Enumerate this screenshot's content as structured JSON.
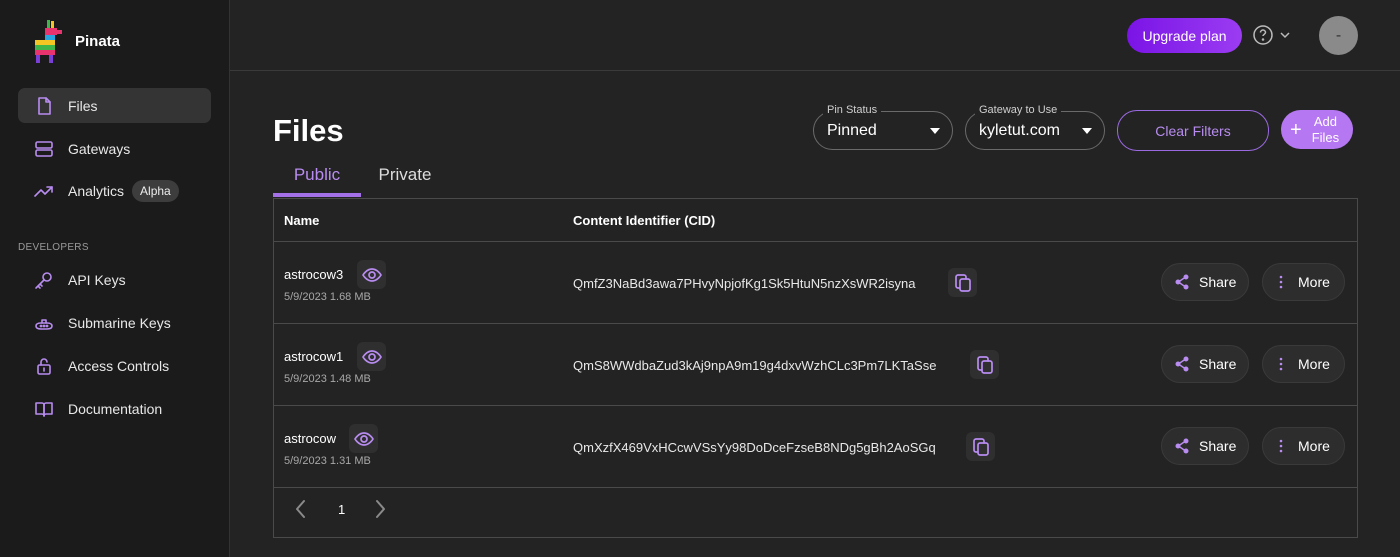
{
  "app": {
    "brand_name": "Pinata"
  },
  "sidebar": {
    "items": [
      {
        "label": "Files",
        "icon": "file-icon",
        "active": true
      },
      {
        "label": "Gateways",
        "icon": "server-icon",
        "active": false
      },
      {
        "label": "Analytics",
        "icon": "trend-up-icon",
        "active": false,
        "badge": "Alpha"
      }
    ],
    "section_label": "DEVELOPERS",
    "developer_items": [
      {
        "label": "API Keys",
        "icon": "key-icon"
      },
      {
        "label": "Submarine Keys",
        "icon": "submarine-icon"
      },
      {
        "label": "Access Controls",
        "icon": "lock-icon"
      },
      {
        "label": "Documentation",
        "icon": "book-icon"
      }
    ]
  },
  "topbar": {
    "upgrade_label": "Upgrade plan",
    "help_icon": "question-circle-icon",
    "avatar_text": "-"
  },
  "main": {
    "title": "Files",
    "filters": {
      "pin_status": {
        "legend": "Pin Status",
        "value": "Pinned"
      },
      "gateway": {
        "legend": "Gateway to Use",
        "value": "kyletut.com"
      }
    },
    "clear_filters_label": "Clear Filters",
    "add_files_label_line1": "Add",
    "add_files_label_line2": "Files",
    "tabs": [
      {
        "label": "Public",
        "active": true
      },
      {
        "label": "Private",
        "active": false
      }
    ],
    "table": {
      "columns": [
        "Name",
        "Content Identifier (CID)"
      ],
      "rows": [
        {
          "name": "astrocow3",
          "date": "5/9/2023",
          "size": "1.68 MB",
          "cid": "QmfZ3NaBd3awa7PHvyNpjofKg1Sk5HtuN5nzXsWR2isyna"
        },
        {
          "name": "astrocow1",
          "date": "5/9/2023",
          "size": "1.48 MB",
          "cid": "QmS8WWdbaZud3kAj9npA9m19g4dxvWzhCLc3Pm7LKTaSse"
        },
        {
          "name": "astrocow",
          "date": "5/9/2023",
          "size": "1.31 MB",
          "cid": "QmXzfX469VxHCcwVSsYy98DoDceFzseB8NDg5gBh2AoSGq"
        }
      ],
      "share_label": "Share",
      "more_label": "More"
    },
    "pagination": {
      "current_page": "1"
    }
  },
  "colors": {
    "accent": "#b88cf0",
    "upgrade_gradient_start": "#7a14e6",
    "background": "#232323",
    "sidebar_bg": "#1b1b1b"
  }
}
